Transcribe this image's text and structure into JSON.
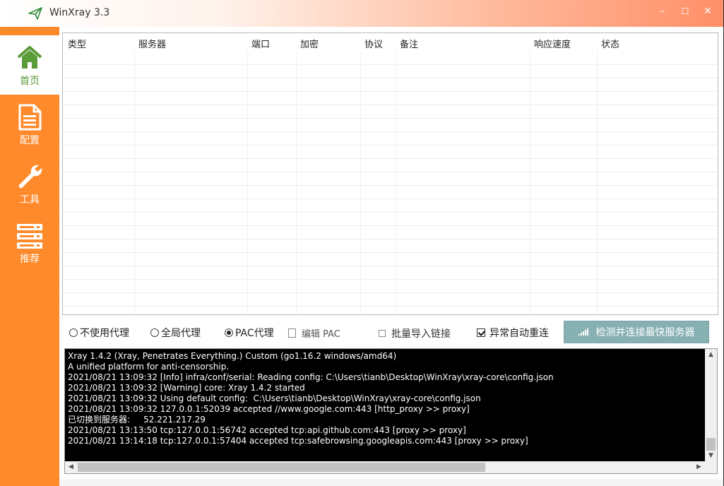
{
  "app": {
    "title": "WinXray 3.3",
    "colors": {
      "sidebar": "#ff8a2b",
      "accent_active": "#5a9b3a",
      "button": "#87b0b3",
      "title_gradient_end": "#ff8f67"
    }
  },
  "window_controls": {
    "minimize": "–",
    "maximize": "☐",
    "close": "✕"
  },
  "sidebar": {
    "items": [
      {
        "label": "首页",
        "icon": "home-icon",
        "active": true
      },
      {
        "label": "配置",
        "icon": "document-icon",
        "active": false
      },
      {
        "label": "工具",
        "icon": "wrench-icon",
        "active": false
      },
      {
        "label": "推荐",
        "icon": "server-icon",
        "active": false
      }
    ]
  },
  "table": {
    "columns": [
      "类型",
      "服务器",
      "端口",
      "加密",
      "协议",
      "备注",
      "响应速度",
      "状态"
    ],
    "rows": []
  },
  "controls": {
    "radio_no_proxy": "不使用代理",
    "radio_global": "全局代理",
    "radio_pac": "PAC代理",
    "selected": "PAC代理",
    "edit_pac": "编辑 PAC",
    "batch_import": "批量导入链接",
    "auto_reconnect": "异常自动重连",
    "auto_reconnect_checked": true,
    "detect_connect": "检测并连接最快服务器"
  },
  "log": {
    "lines": [
      "Xray 1.4.2 (Xray, Penetrates Everything.) Custom (go1.16.2 windows/amd64)",
      "A unified platform for anti-censorship.",
      "2021/08/21 13:09:32 [Info] infra/conf/serial: Reading config: C:\\Users\\tianb\\Desktop\\WinXray\\xray-core\\config.json",
      "2021/08/21 13:09:32 [Warning] core: Xray 1.4.2 started",
      "2021/08/21 13:09:32 Using default config:  C:\\Users\\tianb\\Desktop\\WinXray\\xray-core\\config.json",
      "2021/08/21 13:09:32 127.0.0.1:52039 accepted //www.google.com:443 [http_proxy >> proxy]",
      "已切换到服务器:     52.221.217.29",
      "2021/08/21 13:13:50 tcp:127.0.0.1:56742 accepted tcp:api.github.com:443 [proxy >> proxy]",
      "2021/08/21 13:14:18 tcp:127.0.0.1:57404 accepted tcp:safebrowsing.googleapis.com:443 [proxy >> proxy]"
    ]
  }
}
